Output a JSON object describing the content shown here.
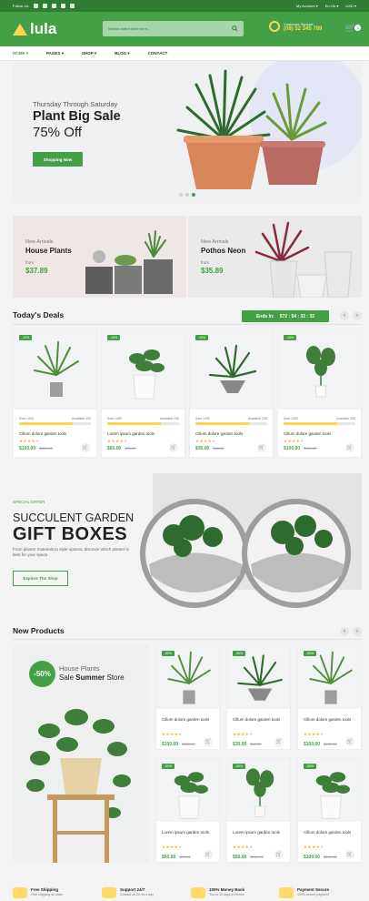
{
  "topbar": {
    "follow_label": "Follow Us",
    "account": "My Account",
    "language": "En-Gb",
    "currency": "USD"
  },
  "header": {
    "logo_text": "lula",
    "search_placeholder": "Search entire store here...",
    "support_label": "Customer Support",
    "support_phone": "(08) 52 345 789",
    "cart_count": "0"
  },
  "nav": {
    "items": [
      "HOME",
      "PAGES",
      "SHOP",
      "BLOG",
      "CONTACT"
    ]
  },
  "hero": {
    "line1": "Thursday Through Saturday",
    "line2": "Plant Big Sale",
    "line3": "75% Off",
    "button": "Shopping Now"
  },
  "promos": [
    {
      "subtitle": "New Arrivals",
      "name": "House Plants",
      "from": "from",
      "price": "$37.89"
    },
    {
      "subtitle": "New Arrivals",
      "name": "Pothos Neon",
      "from": "from",
      "price": "$35.89"
    }
  ],
  "deals": {
    "title": "Today's Deals",
    "ends_label": "Ends In:",
    "countdown": "572 : 54 : 32 : 32",
    "items": [
      {
        "discount": "-10%",
        "sold": "Sold 1400",
        "available": "Available 230",
        "progress": 0.75,
        "name": "Cillum dolore garden tools",
        "price": "$100.00",
        "old": "$120.00"
      },
      {
        "discount": "-10%",
        "sold": "Sold 1400",
        "available": "Available 230",
        "progress": 0.75,
        "name": "Lorem ipsum garden tools",
        "price": "$50.00",
        "old": "$70.00"
      },
      {
        "discount": "-10%",
        "sold": "Sold 1400",
        "available": "Available 230",
        "progress": 0.75,
        "name": "Cillum dolore garden tools",
        "price": "$30.00",
        "old": "$60.00"
      },
      {
        "discount": "-10%",
        "sold": "Sold 1400",
        "available": "Available 230",
        "progress": 0.75,
        "name": "Cillum dolore garden tools",
        "price": "$100.00",
        "old": "$120.00"
      }
    ]
  },
  "special": {
    "tag": "SPECIAL OFFER",
    "line1": "SUCCULENT GARDEN",
    "line2": "GIFT BOXES",
    "desc": "From planter materials to style options, discover which planter is best for your space.",
    "button": "Explore The Shop"
  },
  "new_products": {
    "title": "New Products",
    "banner": {
      "badge": "-50%",
      "subtitle": "House Plants",
      "name_pre": "Sale",
      "name_bold": "Summer",
      "name_post": "Store"
    },
    "items": [
      {
        "discount": "-50%",
        "name": "Cillum dolore garden tools",
        "price": "$100.00",
        "old": "$120.00"
      },
      {
        "discount": "-50%",
        "name": "Cillum dolore garden tools",
        "price": "$30.00",
        "old": "$60.00"
      },
      {
        "discount": "-50%",
        "name": "Cillum dolore garden tools",
        "price": "$100.00",
        "old": "$120.00"
      },
      {
        "discount": "-50%",
        "name": "Lorem ipsum garden tools",
        "price": "$50.00",
        "old": "$70.00"
      },
      {
        "discount": "-50%",
        "name": "Lorem ipsum garden tools",
        "price": "$50.00",
        "old": "$120.00"
      },
      {
        "discount": "-50%",
        "name": "Cillum dolore garden tools",
        "price": "$100.00",
        "old": "$120.00"
      }
    ]
  },
  "features": [
    {
      "title": "Free Shipping",
      "sub": "Free shipping on order"
    },
    {
      "title": "Support 24/7",
      "sub": "Contact us 24 hrs a day"
    },
    {
      "title": "100% Money Back",
      "sub": "You've 30 days to Return"
    },
    {
      "title": "Payment Secure",
      "sub": "100% secure payment"
    }
  ],
  "colors": {
    "primary": "#43a047",
    "dark": "#2e7d32",
    "accent": "#ffd54f"
  }
}
